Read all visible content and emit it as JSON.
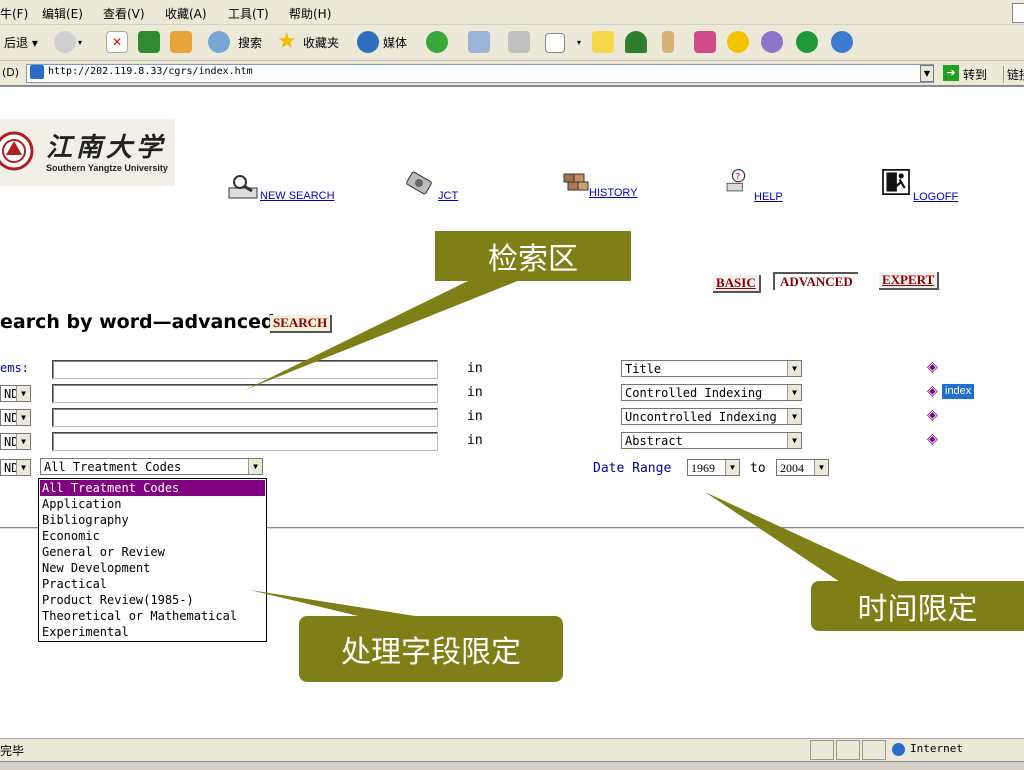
{
  "menu": {
    "items": [
      "牛(F)",
      "编辑(E)",
      "查看(V)",
      "收藏(A)",
      "工具(T)",
      "帮助(H)"
    ]
  },
  "toolbar": {
    "back_label": "后退",
    "search_label": "搜索",
    "favorites_label": "收藏夹",
    "media_label": "媒体"
  },
  "address": {
    "label": "(D)",
    "url": "http://202.119.8.33/cgrs/index.htm",
    "go_label": "转到",
    "links_label": "链接"
  },
  "logo": {
    "chinese": "江南大学",
    "english": "Southern Yangtze University"
  },
  "nav": {
    "new_search": "NEW SEARCH",
    "jct": "JCT",
    "history": "HISTORY",
    "help": "HELP",
    "logoff": "LOGOFF"
  },
  "mode_tabs": {
    "basic": "BASIC",
    "advanced": "ADVANCED",
    "expert": "EXPERT"
  },
  "search": {
    "heading": "earch by word—advanced",
    "search_button": "SEARCH",
    "terms_label": "ems:",
    "and_label": "ND",
    "in_label": "in",
    "rows": [
      {
        "field": "Title"
      },
      {
        "field": "Controlled Indexing"
      },
      {
        "field": "Uncontrolled Indexing"
      },
      {
        "field": "Abstract"
      }
    ],
    "index_label": "index",
    "treatment_value": "All Treatment Codes",
    "treatment_options": [
      "All Treatment Codes",
      "Application",
      "Bibliography",
      "Economic",
      "General or Review",
      "New Development",
      "Practical",
      "Product Review(1985-)",
      "Theoretical or Mathematical",
      "Experimental"
    ],
    "date_range_label": "Date Range",
    "date_from": "1969",
    "date_to_label": "to",
    "date_to": "2004"
  },
  "callouts": {
    "search_area": "检索区",
    "treatment_limit": "处理字段限定",
    "time_limit": "时间限定"
  },
  "status": {
    "text": "完毕",
    "zone": "Internet"
  },
  "colors": {
    "callout_bg": "#7f7f17",
    "selected_option": "#800080",
    "link": "#0000cc",
    "mode_tab_text": "#8b0000"
  }
}
